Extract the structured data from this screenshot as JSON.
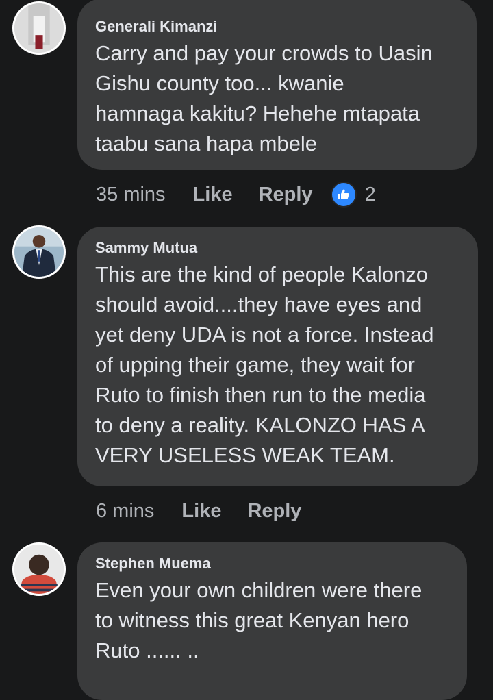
{
  "comments": [
    {
      "author": "Generali Kimanzi",
      "lines": [
        "Carry and pay your crowds to Uasin",
        "Gishu county too... kwanie",
        "hamnaga kakitu? Hehehe mtapata",
        "taabu sana hapa mbele"
      ],
      "time": "35 mins",
      "like_label": "Like",
      "reply_label": "Reply",
      "reaction_icon": "thumbs-up-icon",
      "reaction_count": "2"
    },
    {
      "author": "Sammy Mutua",
      "lines": [
        "This are the kind of people Kalonzo",
        "should avoid....they have eyes and",
        "yet deny UDA is not a force. Instead",
        "of upping their game, they wait for",
        "Ruto to finish then run to the media",
        "to deny a reality. KALONZO HAS A",
        "VERY USELESS WEAK TEAM."
      ],
      "time": "6 mins",
      "like_label": "Like",
      "reply_label": "Reply"
    },
    {
      "author": "Stephen Muema",
      "lines": [
        "Even your own children were there",
        "to witness this great Kenyan hero",
        "Ruto ...... .."
      ]
    }
  ],
  "colors": {
    "background": "#18191a",
    "bubble": "#3a3b3c",
    "text": "#e4e6eb",
    "meta": "#b0b3b8",
    "like_blue": "#2d88ff"
  }
}
